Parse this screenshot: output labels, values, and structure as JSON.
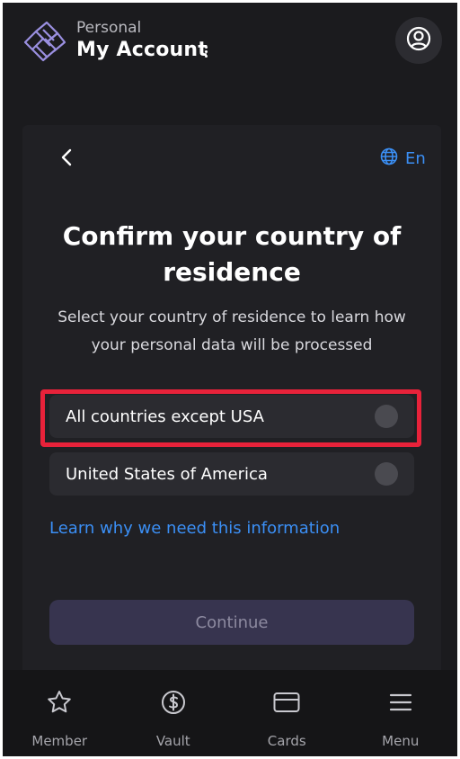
{
  "header": {
    "account_type": "Personal",
    "account_name": "My Account",
    "logo_icon": "brand-logo-icon",
    "more_icon": "kebab-icon",
    "profile_icon": "user-circle-icon"
  },
  "card": {
    "back_icon": "chevron-left-icon",
    "language": {
      "icon": "globe-icon",
      "label": "En"
    },
    "title": "Confirm your country of residence",
    "subtitle": "Select your country of residence to learn how your personal data will be processed",
    "options": [
      {
        "label": "All countries except USA",
        "selected": false,
        "highlighted": true
      },
      {
        "label": "United States of America",
        "selected": false,
        "highlighted": false
      }
    ],
    "learn_link": "Learn why we need this information",
    "continue_label": "Continue"
  },
  "bottom_nav": {
    "items": [
      {
        "label": "Member",
        "icon": "star-icon"
      },
      {
        "label": "Vault",
        "icon": "dollar-coin-icon"
      },
      {
        "label": "Cards",
        "icon": "card-icon"
      },
      {
        "label": "Menu",
        "icon": "hamburger-menu-icon"
      }
    ]
  },
  "colors": {
    "background": "#1b1b1e",
    "accent_link": "#3b8ff5",
    "highlight_border": "#e8223a",
    "button_disabled": "#37344f"
  }
}
